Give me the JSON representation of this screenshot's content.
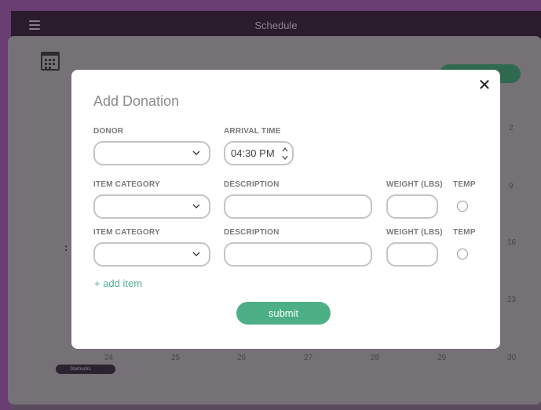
{
  "header": {
    "title": "Schedule"
  },
  "calendar": {
    "day_numbers": [
      {
        "label": "2"
      },
      {
        "label": "9"
      },
      {
        "label": "16"
      },
      {
        "label": "23"
      },
      {
        "label": "24"
      },
      {
        "label": "25"
      },
      {
        "label": "26"
      },
      {
        "label": "27"
      },
      {
        "label": "28"
      },
      {
        "label": "29"
      },
      {
        "label": "30"
      }
    ],
    "event": {
      "label": "Starbucks"
    }
  },
  "modal": {
    "title": "Add Donation",
    "close_icon": "close-icon",
    "donor": {
      "label": "DONOR",
      "value": ""
    },
    "arrival_time": {
      "label": "ARRIVAL TIME",
      "value": "04:30 PM"
    },
    "items": [
      {
        "category_label": "ITEM CATEGORY",
        "category_value": "",
        "description_label": "DESCRIPTION",
        "description_value": "",
        "weight_label": "WEIGHT (LBS)",
        "weight_value": "",
        "temp_label": "TEMP"
      },
      {
        "category_label": "ITEM CATEGORY",
        "category_value": "",
        "description_label": "DESCRIPTION",
        "description_value": "",
        "weight_label": "WEIGHT (LBS)",
        "weight_value": "",
        "temp_label": "TEMP"
      }
    ],
    "add_item_label": "+ add item",
    "submit_label": "submit"
  },
  "colors": {
    "accent": "#4caf86",
    "page_background": "#6a3d73",
    "topbar": "#2a1c2c"
  }
}
